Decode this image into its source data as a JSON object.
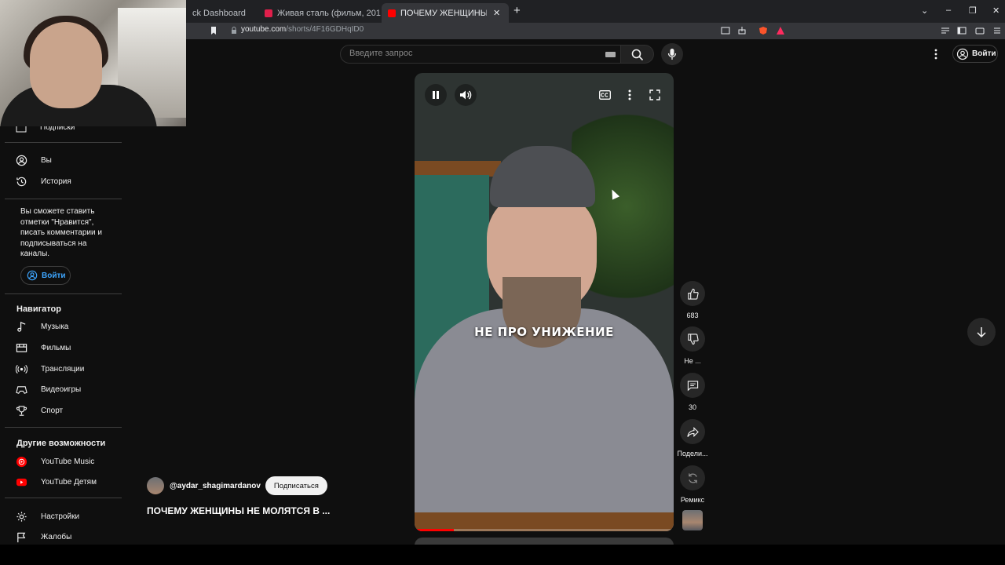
{
  "browser": {
    "tabs": [
      {
        "label": "ck Dashboard",
        "active": false
      },
      {
        "label": "Живая сталь (фильм, 2011) - смотре",
        "active": false
      },
      {
        "label": "ПОЧЕМУ ЖЕНЩИНЫ НЕ МО",
        "active": true
      }
    ],
    "url_host": "youtube.com",
    "url_path": "/shorts/4F16GDHqID0"
  },
  "header": {
    "search_placeholder": "Введите запрос",
    "signin_label": "Войти"
  },
  "sidebar": {
    "partial_item": "Подписки",
    "you_items": [
      {
        "label": "Вы",
        "icon": "account-icon"
      },
      {
        "label": "История",
        "icon": "history-icon"
      }
    ],
    "signin_note": "Вы сможете ставить отметки \"Нравится\", писать комментарии и подписываться на каналы.",
    "signin_label": "Войти",
    "nav_heading": "Навигатор",
    "nav_items": [
      {
        "label": "Музыка",
        "icon": "music-icon"
      },
      {
        "label": "Фильмы",
        "icon": "film-icon"
      },
      {
        "label": "Трансляции",
        "icon": "live-icon"
      },
      {
        "label": "Видеоигры",
        "icon": "gamepad-icon"
      },
      {
        "label": "Спорт",
        "icon": "trophy-icon"
      }
    ],
    "more_heading": "Другие возможности",
    "more_items": [
      {
        "label": "YouTube Music",
        "icon": "youtube-music-icon"
      },
      {
        "label": "YouTube Детям",
        "icon": "youtube-kids-icon"
      }
    ],
    "settings_items": [
      {
        "label": "Настройки",
        "icon": "gear-icon"
      },
      {
        "label": "Жалобы",
        "icon": "flag-icon"
      }
    ]
  },
  "video": {
    "caption": "НЕ ПРО УНИЖЕНИЕ",
    "progress": 0.15
  },
  "actions": {
    "likes": "683",
    "dislike": "Не ...",
    "comments": "30",
    "share": "Подели...",
    "remix": "Ремикс"
  },
  "owner": {
    "channel": "@aydar_shagimardanov",
    "subscribe_label": "Подписаться",
    "title": "ПОЧЕМУ ЖЕНЩИНЫ НЕ МОЛЯТСЯ В ..."
  },
  "colors": {
    "background": "#0f0f0f",
    "accent_red": "#ff0000",
    "link_blue": "#3ea6ff"
  }
}
